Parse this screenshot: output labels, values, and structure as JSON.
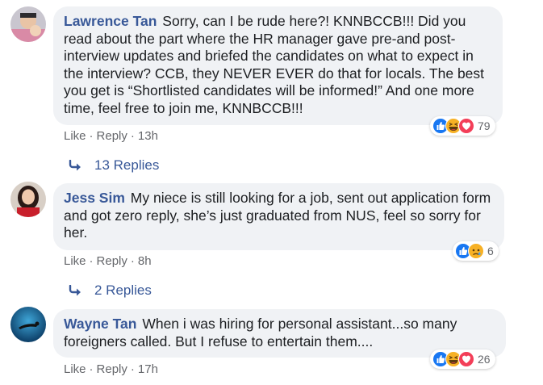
{
  "comments": [
    {
      "author": "Lawrence Tan",
      "text": "Sorry, can I be rude here?! KNNBCCB!!! Did you read about the part where the HR manager gave pre-and post-interview updates and briefed the candidates on what to expect in the interview? CCB, they NEVER EVER do that for locals. The best you get is “Shortlisted candidates will be informed!” And one more time, feel free to join me, KNNBCCB!!!",
      "like_label": "Like",
      "reply_label": "Reply",
      "time": "13h",
      "reactions": [
        "like",
        "haha",
        "love"
      ],
      "reaction_count": "79",
      "replies_label": "13 Replies"
    },
    {
      "author": "Jess Sim",
      "text": "My niece is still looking for a job, sent out application form and got zero reply, she’s just graduated from NUS, feel so sorry for her.",
      "like_label": "Like",
      "reply_label": "Reply",
      "time": "8h",
      "reactions": [
        "like",
        "sad"
      ],
      "reaction_count": "6",
      "replies_label": "2 Replies"
    },
    {
      "author": "Wayne Tan",
      "text": "When i was hiring for personal assistant...so many foreigners called. But I refuse to entertain them....",
      "like_label": "Like",
      "reply_label": "Reply",
      "time": "17h",
      "reactions": [
        "like",
        "haha",
        "love"
      ],
      "reaction_count": "26"
    }
  ],
  "colors": {
    "author": "#385898",
    "bubble_bg": "#f0f2f5",
    "meta": "#65676b",
    "like_blue": "#1877f2",
    "love_red": "#f33e58",
    "emoji_yellow": "#f7b125"
  }
}
